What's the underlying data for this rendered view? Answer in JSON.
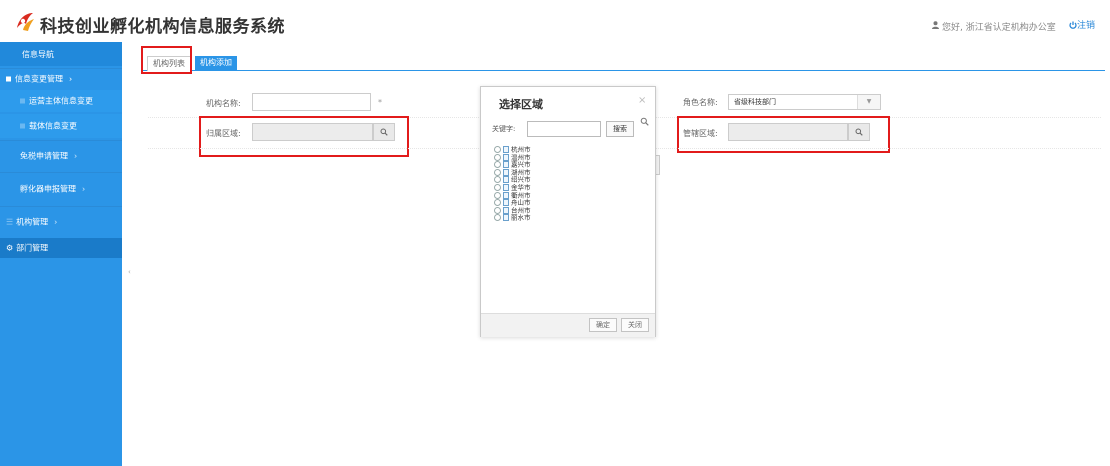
{
  "header": {
    "app_title": "科技创业孵化机构信息服务系统",
    "greeting": "您好, 浙江省认定机构办公室",
    "logout_label": "注销",
    "accent": "#2b95e7"
  },
  "sidebar": {
    "heading": "信息导航",
    "items": [
      {
        "label": "信息变更管理",
        "chevron": "›"
      },
      {
        "label": "运营主体信息变更"
      },
      {
        "label": "载体信息变更"
      },
      {
        "label": "免税申请管理",
        "chevron": "›"
      },
      {
        "label": "孵化器申报管理",
        "chevron": "›"
      },
      {
        "label": "机构管理",
        "chevron": "›"
      },
      {
        "label": "部门管理"
      }
    ]
  },
  "tabs": [
    {
      "label": "机构列表"
    },
    {
      "label": "机构添加"
    }
  ],
  "form": {
    "org_name_label": "机构名称:",
    "required_mark": "*",
    "region_label": "归属区域:",
    "role_label": "角色名称:",
    "role_value": "省级科技部门",
    "manage_region_label": "管辖区域:"
  },
  "modal": {
    "title": "选择区域",
    "close": "×",
    "keyword_label": "关键字:",
    "search_button": "搜索",
    "cities": [
      "杭州市",
      "温州市",
      "嘉兴市",
      "湖州市",
      "绍兴市",
      "金华市",
      "衢州市",
      "舟山市",
      "台州市",
      "丽水市"
    ],
    "confirm_button": "确定",
    "close_button": "关闭"
  }
}
